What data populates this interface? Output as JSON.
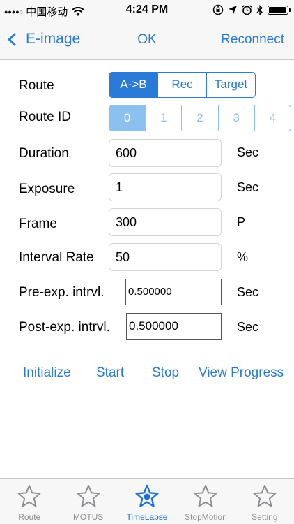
{
  "status_bar": {
    "signal_dots": "●●●●○",
    "carrier": "中国移动",
    "wifi_icon": "wifi-icon",
    "time": "4:24 PM",
    "battery_level": 0.92
  },
  "nav": {
    "back_label": "E-image",
    "center_label": "OK",
    "right_label": "Reconnect"
  },
  "form": {
    "route_label": "Route",
    "route_options": [
      "A->B",
      "Rec",
      "Target"
    ],
    "route_selected": "A->B",
    "route_id_label": "Route ID",
    "route_id_options": [
      "0",
      "1",
      "2",
      "3",
      "4"
    ],
    "route_id_selected": "0",
    "duration_label": "Duration",
    "duration_value": "600",
    "duration_unit": "Sec",
    "exposure_label": "Exposure",
    "exposure_value": "1",
    "exposure_unit": "Sec",
    "frame_label": "Frame",
    "frame_value": "300",
    "frame_unit": "P",
    "interval_label": "Interval Rate",
    "interval_value": "50",
    "interval_unit": "%",
    "pre_label": "Pre-exp. intrvl.",
    "pre_value": "0.500000",
    "pre_unit": "Sec",
    "post_label": "Post-exp. intrvl.",
    "post_value": "0.500000",
    "post_unit": "Sec"
  },
  "actions": {
    "initialize": "Initialize",
    "start": "Start",
    "stop": "Stop",
    "view_progress": "View Progress"
  },
  "tabs": [
    {
      "label": "Route",
      "icon": "star-icon",
      "active": false
    },
    {
      "label": "MOTUS",
      "icon": "star-icon",
      "active": false
    },
    {
      "label": "TimeLapse",
      "icon": "star-icon",
      "active": true
    },
    {
      "label": "StopMotion",
      "icon": "star-icon",
      "active": false
    },
    {
      "label": "Setting",
      "icon": "star-icon",
      "active": false
    }
  ],
  "colors": {
    "accent": "#2a7ad8",
    "accent_light": "#8cc0ee",
    "tab_inactive": "#8e8e93"
  }
}
